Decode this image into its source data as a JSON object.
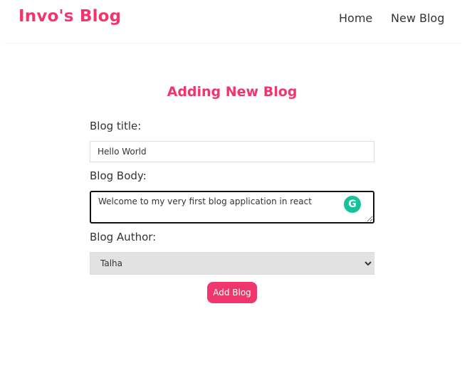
{
  "navbar": {
    "brand": "Invo's Blog",
    "links": [
      {
        "label": "Home"
      },
      {
        "label": "New Blog"
      }
    ]
  },
  "create": {
    "heading": "Adding New Blog",
    "title_label": "Blog title:",
    "title_value": "Hello World",
    "body_label": "Blog Body:",
    "body_value": "Welcome to my very first blog application in react",
    "author_label": "Blog Author:",
    "author_selected": "Talha",
    "submit_label": "Add Blog"
  },
  "colors": {
    "accent": "#f1356d",
    "grammarly": "#15c39a"
  },
  "icons": {
    "grammarly": "grammarly-g-icon"
  }
}
